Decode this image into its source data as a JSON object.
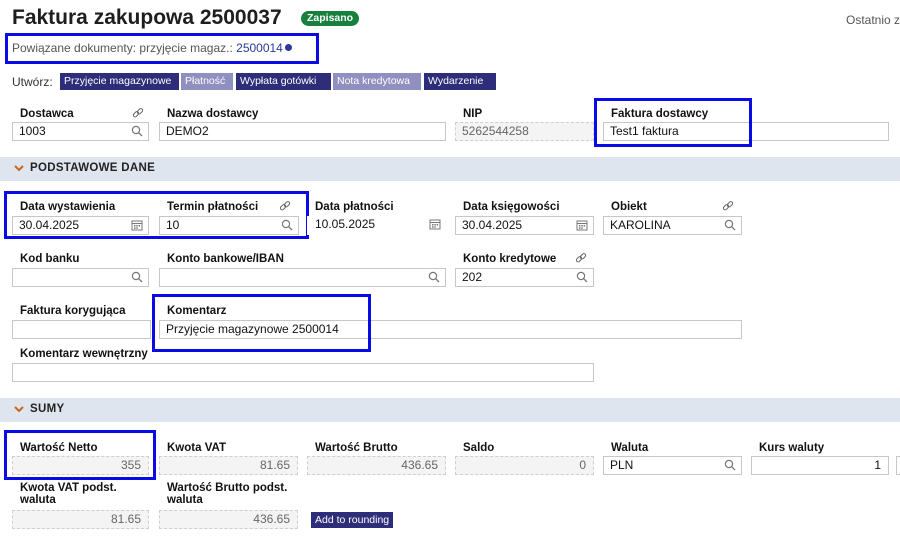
{
  "header": {
    "title": "Faktura zakupowa 2500037",
    "status_badge": "Zapisano",
    "last_changed_partial": "Ostatnio z"
  },
  "linked_docs": {
    "label": "Powiązane dokumenty:",
    "type": "przyjęcie magaz.:",
    "number": "2500014"
  },
  "create": {
    "label": "Utwórz:",
    "buttons": [
      {
        "label": "Przyjęcie magazynowe",
        "enabled": true
      },
      {
        "label": "Płatność",
        "enabled": false
      },
      {
        "label": "Wypłata gotówki",
        "enabled": true
      },
      {
        "label": "Nota kredytowa",
        "enabled": false
      },
      {
        "label": "Wydarzenie",
        "enabled": true
      }
    ]
  },
  "supplier": {
    "dostawca_label": "Dostawca",
    "dostawca_value": "1003",
    "nazwa_label": "Nazwa dostawcy",
    "nazwa_value": "DEMO2",
    "nip_label": "NIP",
    "nip_value": "5262544258",
    "faktura_label": "Faktura dostawcy",
    "faktura_value": "Test1 faktura"
  },
  "sections": {
    "basic": "PODSTAWOWE DANE",
    "sums": "SUMY"
  },
  "basic": {
    "data_wyst_label": "Data wystawienia",
    "data_wyst_value": "30.04.2025",
    "termin_label": "Termin płatności",
    "termin_value": "10",
    "data_plat_label": "Data płatności",
    "data_plat_value": "10.05.2025",
    "data_ksieg_label": "Data księgowości",
    "data_ksieg_value": "30.04.2025",
    "obiekt_label": "Obiekt",
    "obiekt_value": "KAROLINA",
    "kod_banku_label": "Kod banku",
    "kod_banku_value": "",
    "konto_label": "Konto bankowe/IBAN",
    "konto_value": "",
    "konto_kred_label": "Konto kredytowe",
    "konto_kred_value": "202",
    "korygujaca_label": "Faktura korygująca",
    "korygujaca_value": "",
    "komentarz_label": "Komentarz",
    "komentarz_value": "Przyjęcie magazynowe 2500014",
    "kom_wewn_label": "Komentarz wewnętrzny",
    "kom_wewn_value": ""
  },
  "sums": {
    "netto_label": "Wartość Netto",
    "netto_value": "355",
    "vat_label": "Kwota VAT",
    "vat_value": "81.65",
    "brutto_label": "Wartość Brutto",
    "brutto_value": "436.65",
    "saldo_label": "Saldo",
    "saldo_value": "0",
    "waluta_label": "Waluta",
    "waluta_value": "PLN",
    "kurs_label": "Kurs waluty",
    "kurs_value": "1",
    "vat_base_label": "Kwota VAT podst. waluta",
    "vat_base_value": "81.65",
    "brutto_base_label": "Wartość Brutto podst. waluta",
    "brutto_base_value": "436.65",
    "rounding_button": "Add to rounding"
  },
  "colors": {
    "badge": "#16803c",
    "button_dark": "#2d2d7a",
    "button_light": "#8f8fc0",
    "section_bg": "#dfe5ef",
    "highlight": "#0a0ae6"
  }
}
